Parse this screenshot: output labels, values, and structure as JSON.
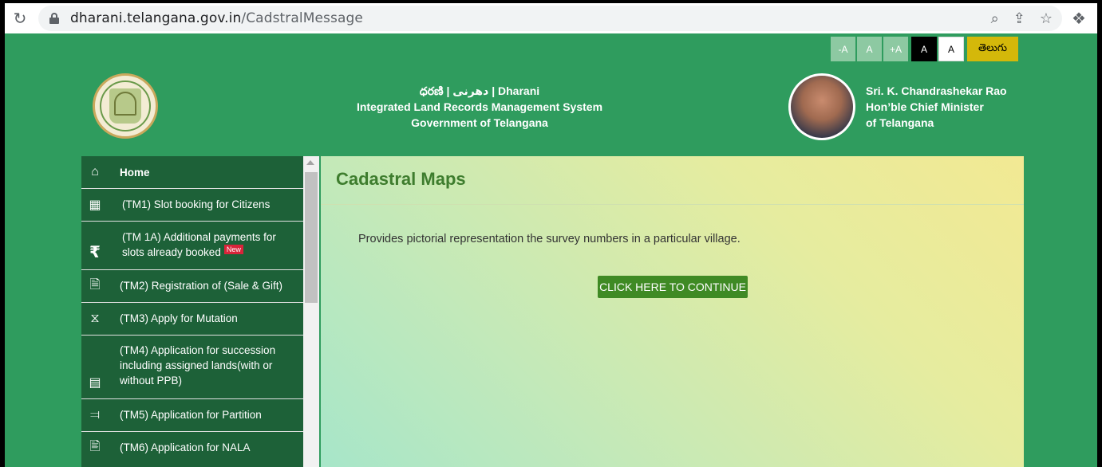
{
  "browser": {
    "url_host": "dharani.telangana.gov.in",
    "url_path": "/CadstralMessage"
  },
  "accessibility": {
    "decrease": "-A",
    "normal": "A",
    "increase": "+A",
    "dark": "A",
    "light": "A",
    "language": "తెలుగు"
  },
  "header": {
    "line1": "ధరణి | دھرنی | Dharani",
    "line2": "Integrated Land Records Management System",
    "line3": "Government of Telangana",
    "cm_name": "Sri. K. Chandrashekar Rao",
    "cm_title": "Hon’ble Chief Minister",
    "cm_state": "of Telangana"
  },
  "sidebar": {
    "items": [
      {
        "label": "Home",
        "icon": "home-icon"
      },
      {
        "label": "(TM1) Slot booking for Citizens",
        "icon": "qr-grid-icon"
      },
      {
        "label": "(TM 1A) Additional payments for slots already booked",
        "icon": "rupee-icon",
        "badge": "New"
      },
      {
        "label": "(TM2) Registration of (Sale & Gift)",
        "icon": "document-stamp-icon"
      },
      {
        "label": "(TM3) Apply for Mutation",
        "icon": "mutation-icon"
      },
      {
        "label": "(TM4) Application for succession including assigned lands(with or without PPB)",
        "icon": "succession-doc-icon"
      },
      {
        "label": "(TM5) Application for Partition",
        "icon": "partition-icon"
      },
      {
        "label": "(TM6) Application for NALA",
        "icon": "file-icon"
      }
    ]
  },
  "main": {
    "title": "Cadastral Maps",
    "description": "Provides pictorial representation the survey numbers in a particular village.",
    "button": "CLICK HERE TO CONTINUE"
  },
  "colors": {
    "page_green": "#2f9c5e",
    "sidebar_green": "#1d6138",
    "button_green": "#3f8a24",
    "title_green": "#3e7d2e",
    "telugu_yellow": "#d4b80a"
  }
}
